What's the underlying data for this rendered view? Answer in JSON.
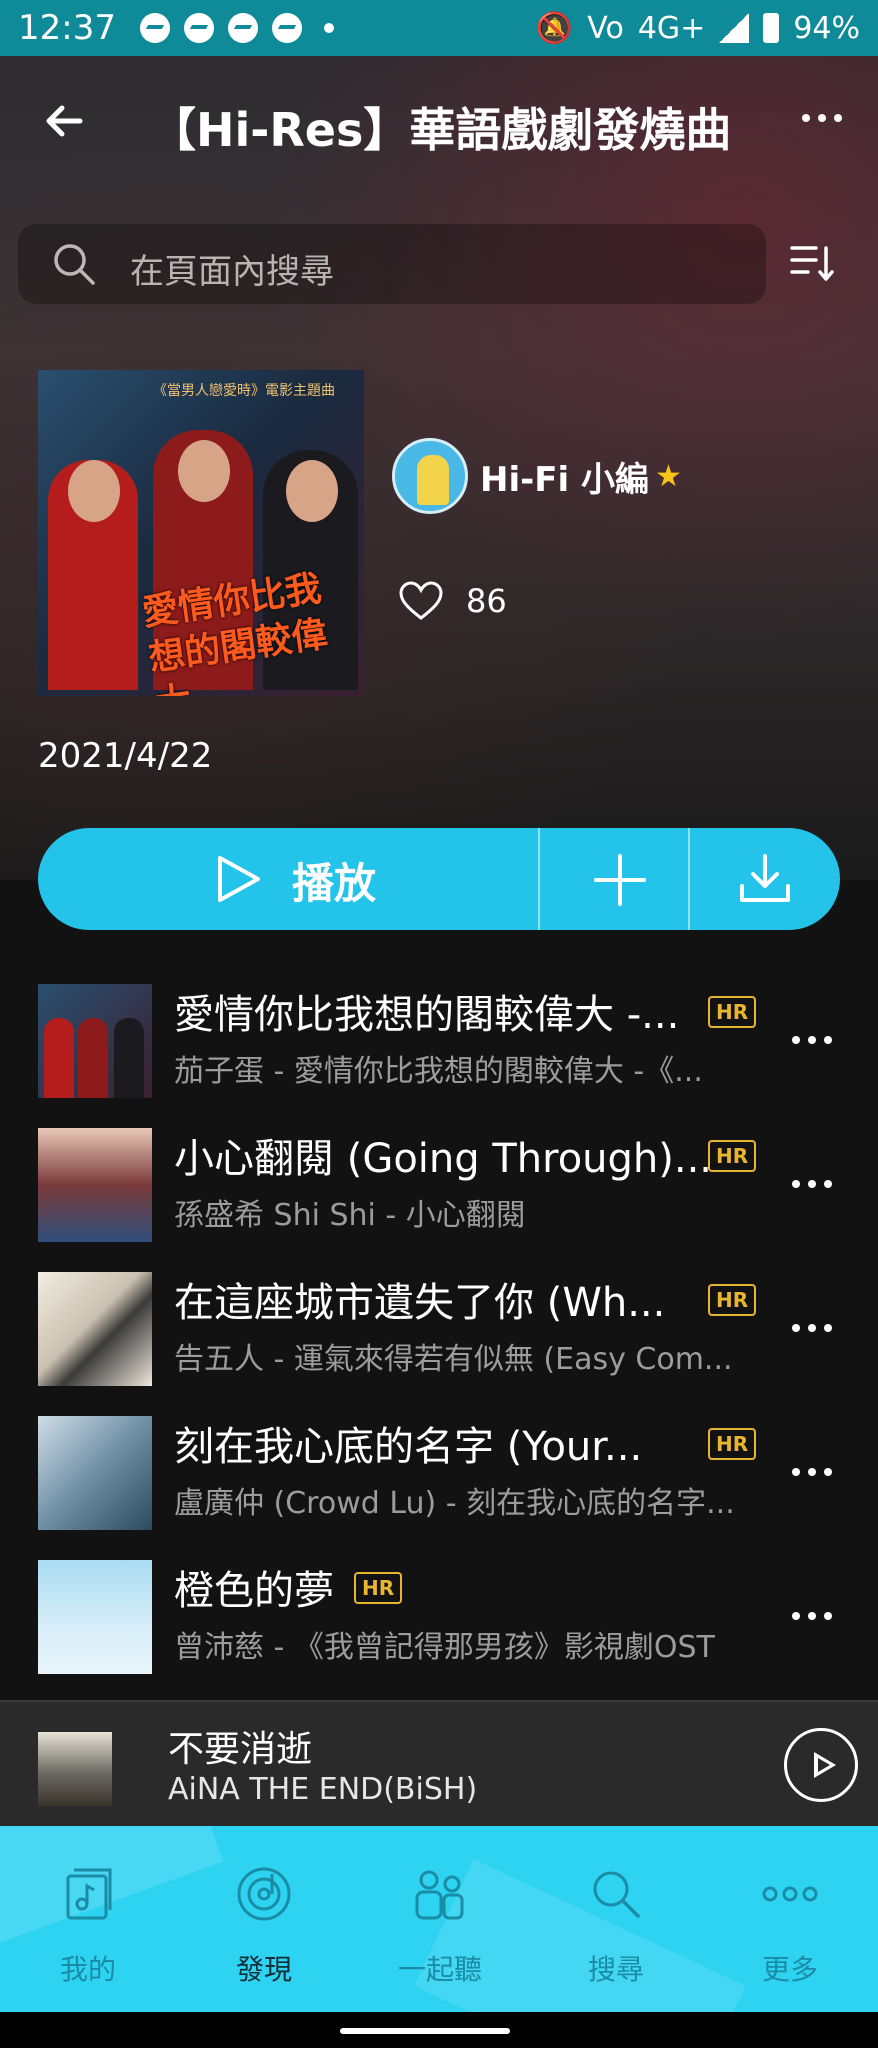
{
  "status_bar": {
    "time": "12:37",
    "right_text": "Vo",
    "network": "4G+",
    "battery": "94%"
  },
  "header": {
    "title": "【Hi-Res】華語戲劇發燒曲"
  },
  "search": {
    "placeholder": "在頁面內搜尋"
  },
  "playlist": {
    "cover_top_text": "《當男人戀愛時》電影主題曲",
    "cover_art_text": "愛情你比我想的閣較偉大",
    "curator": "Hi-Fi 小編",
    "likes": "86",
    "date": "2021/4/22"
  },
  "actions": {
    "play_label": "播放"
  },
  "tracks": [
    {
      "title": "愛情你比我想的閣較偉大 -...",
      "subtitle": "茄子蛋 - 愛情你比我想的閣較偉大 -《...",
      "badge": "HR"
    },
    {
      "title": "小心翻閱 (Going Through)...",
      "subtitle": "孫盛希 Shi Shi - 小心翻閱",
      "badge": "HR"
    },
    {
      "title": "在這座城市遺失了你 (Wh...",
      "subtitle": "告五人 - 運氣來得若有似無 (Easy Com...",
      "badge": "HR"
    },
    {
      "title": "刻在我心底的名字 (Your...",
      "subtitle": "盧廣仲 (Crowd Lu) - 刻在我心底的名字...",
      "badge": "HR"
    },
    {
      "title": "橙色的夢",
      "subtitle": "曾沛慈 - 《我曾記得那男孩》影視劇OST",
      "badge": "HR"
    }
  ],
  "mini_player": {
    "title": "不要消逝",
    "artist": "AiNA THE END(BiSH)"
  },
  "nav": [
    {
      "label": "我的",
      "icon": "library-icon"
    },
    {
      "label": "發現",
      "icon": "disc-icon"
    },
    {
      "label": "一起聽",
      "icon": "people-icon"
    },
    {
      "label": "搜尋",
      "icon": "search-icon"
    },
    {
      "label": "更多",
      "icon": "more-icon"
    }
  ],
  "colors": {
    "accent": "#23c3ea",
    "status_bar": "#0f8a98",
    "hr_badge": "#e7b52f",
    "nav_bg": "#2fd3f2"
  }
}
